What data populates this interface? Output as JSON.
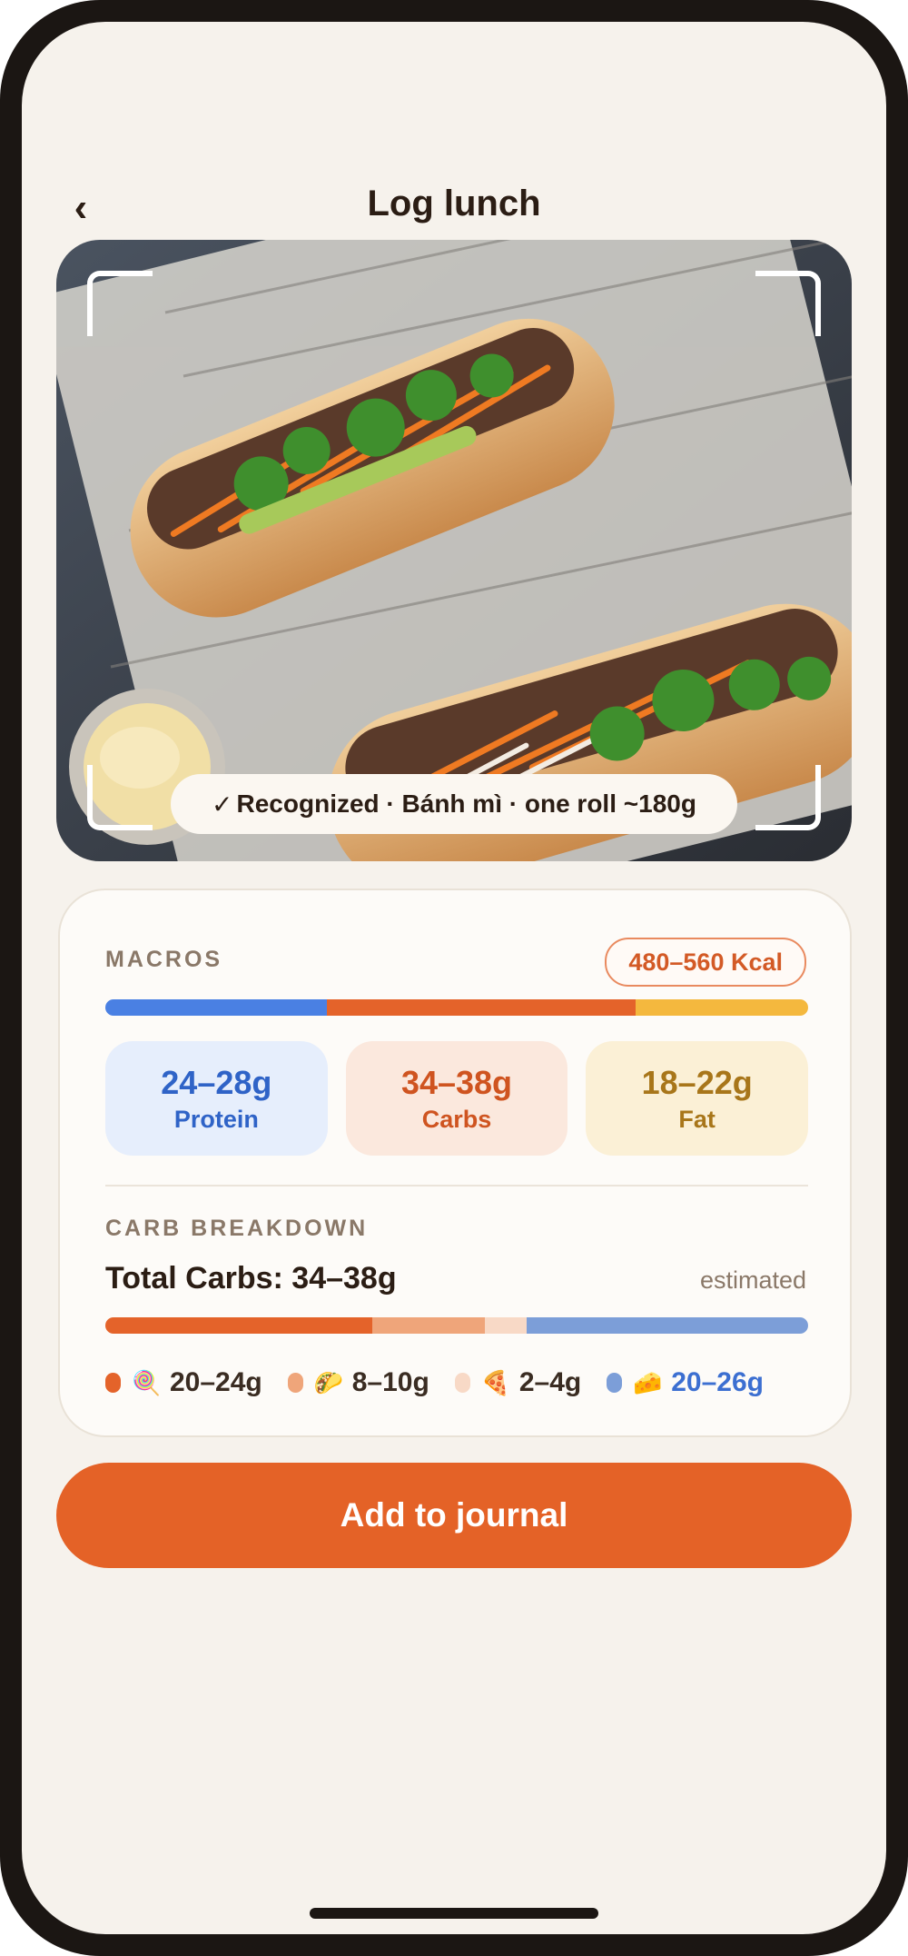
{
  "header": {
    "back_glyph": "‹",
    "title": "Log lunch"
  },
  "photo": {
    "recognized_check": "✓",
    "recognized_text": "Recognized · Bánh mì · one roll ~180g"
  },
  "macros": {
    "label": "MACROS",
    "kcal": "480–560 Kcal",
    "bar_fractions": {
      "protein": 0.315,
      "carbs": 0.44,
      "fat": 0.245
    },
    "protein": {
      "value": "24–28g",
      "label": "Protein"
    },
    "carbs": {
      "value": "34–38g",
      "label": "Carbs"
    },
    "fat": {
      "value": "18–22g",
      "label": "Fat"
    }
  },
  "carb_breakdown": {
    "label": "CARB BREAKDOWN",
    "total": "Total Carbs: 34–38g",
    "note": "estimated",
    "bar_fractions": [
      0.38,
      0.16,
      0.06,
      0.4
    ],
    "legend": [
      {
        "icon": "🍭",
        "icon_name": "lollipop-icon",
        "value": "20–24g",
        "color": "#e4632a"
      },
      {
        "icon": "🌮",
        "icon_name": "taco-icon",
        "value": "8–10g",
        "color": "#efa57a"
      },
      {
        "icon": "🍕",
        "icon_name": "pizza-icon",
        "value": "2–4g",
        "color": "#f8d9c6"
      },
      {
        "icon": "🧀",
        "icon_name": "cheese-icon",
        "value": "20–26g",
        "color": "#7c9ed8"
      }
    ]
  },
  "cta": {
    "label": "Add to journal"
  },
  "colors": {
    "protein": "#4a80e3",
    "carbs": "#e4632a",
    "fat": "#f4b83e",
    "accent": "#e46227"
  }
}
